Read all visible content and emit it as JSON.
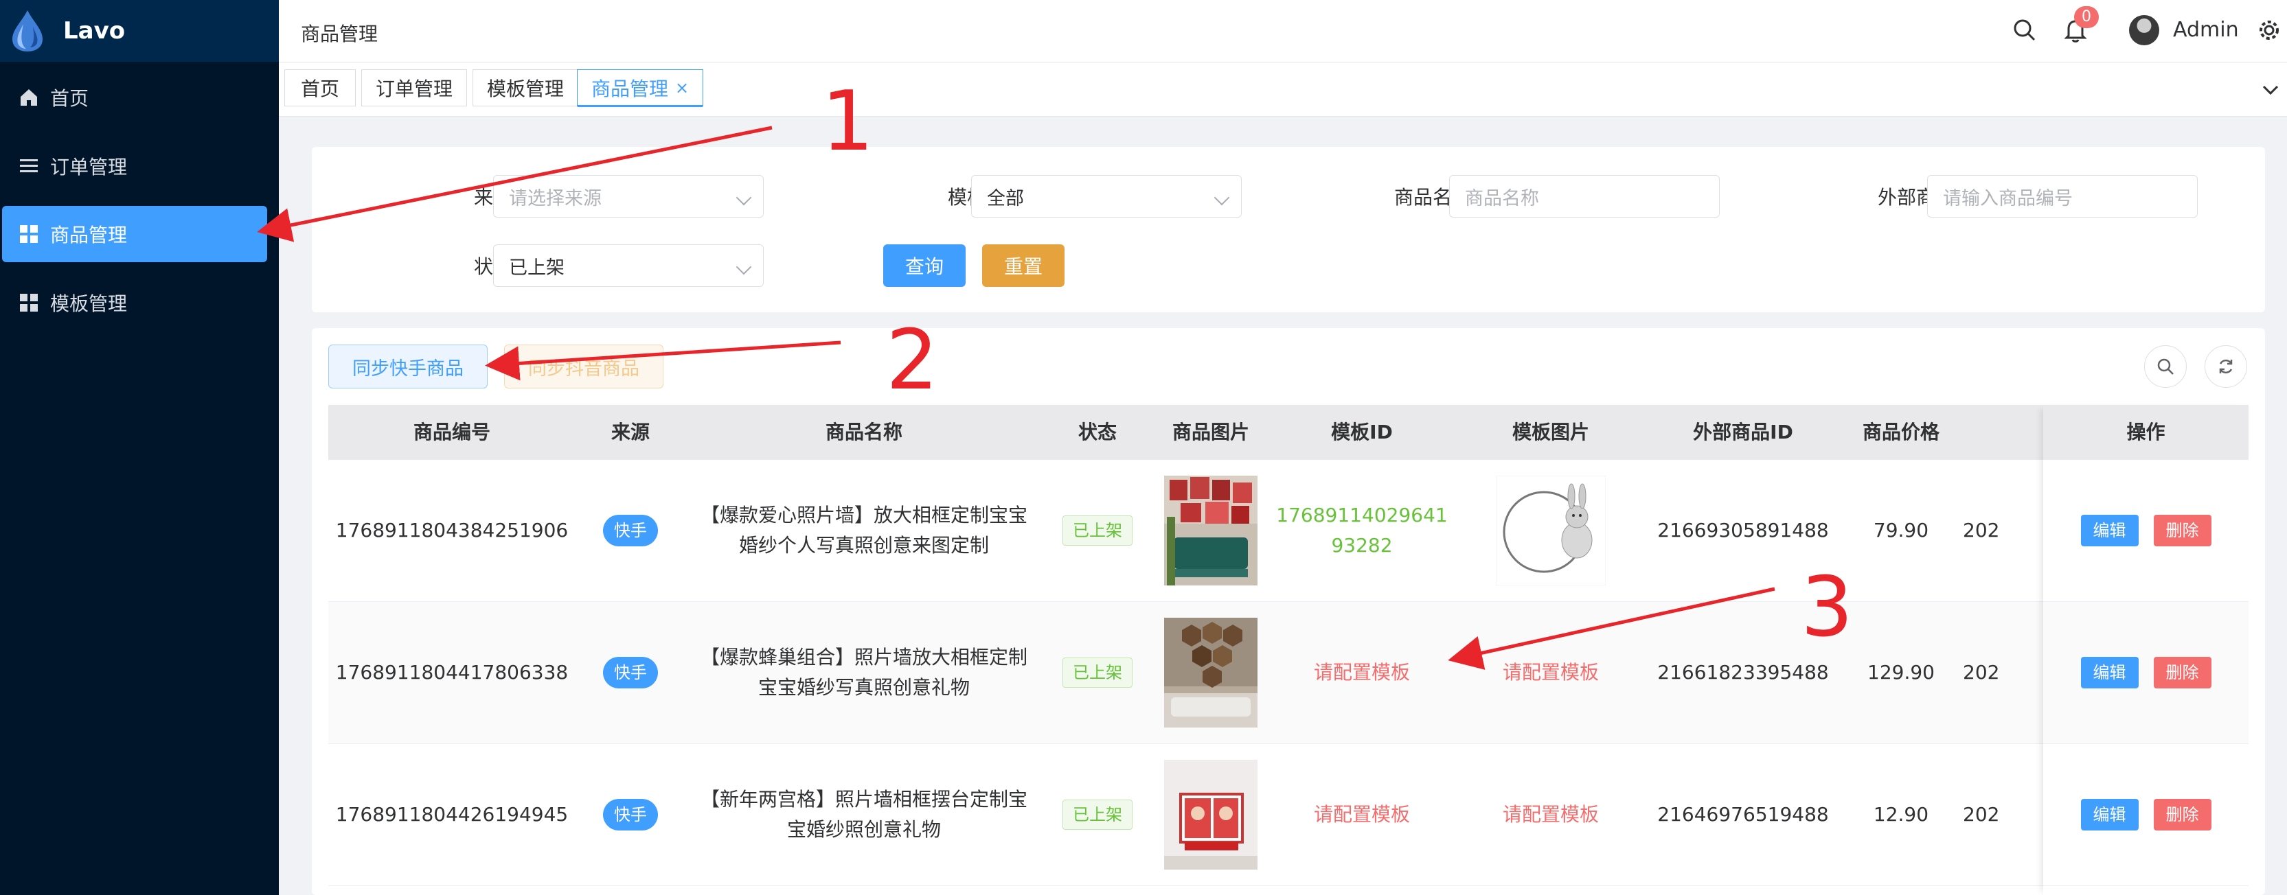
{
  "app": {
    "name": "Lavo"
  },
  "sidebar": {
    "items": [
      {
        "label": "首页",
        "icon": "home-icon"
      },
      {
        "label": "订单管理",
        "icon": "list-icon"
      },
      {
        "label": "商品管理",
        "icon": "grid-icon",
        "active": true
      },
      {
        "label": "模板管理",
        "icon": "grid-icon"
      }
    ]
  },
  "header": {
    "breadcrumb": "商品管理",
    "notification_count": "0",
    "user_name": "Admin"
  },
  "tags": [
    {
      "label": "首页"
    },
    {
      "label": "订单管理"
    },
    {
      "label": "模板管理"
    },
    {
      "label": "商品管理",
      "active": true,
      "close": "×"
    }
  ],
  "filters": {
    "source_label": "来源",
    "source_placeholder": "请选择来源",
    "template_label": "模板",
    "template_value": "全部",
    "name_label": "商品名称",
    "name_placeholder": "商品名称",
    "external_label": "外部商品编号",
    "external_placeholder": "请输入商品编号",
    "status_label": "状态",
    "status_value": "已上架",
    "search_button": "查询",
    "reset_button": "重置"
  },
  "toolbar": {
    "sync_kuaishou": "同步快手商品",
    "sync_douyin": "同步抖音商品"
  },
  "table": {
    "columns": [
      "商品编号",
      "来源",
      "商品名称",
      "状态",
      "商品图片",
      "模板ID",
      "模板图片",
      "外部商品ID",
      "商品价格",
      "操作"
    ],
    "rows": [
      {
        "id": "1768911804384251906",
        "source": "快手",
        "name": "【爆款爱心照片墙】放大相框定制宝宝婚纱个人写真照创意来图定制",
        "status": "已上架",
        "template_id": "1768911402964193282",
        "template_image": "",
        "external_id": "21669305891488",
        "price": "79.90",
        "truncated": "202"
      },
      {
        "id": "1768911804417806338",
        "source": "快手",
        "name": "【爆款蜂巢组合】照片墙放大相框定制宝宝婚纱写真照创意礼物",
        "status": "已上架",
        "template_id": "请配置模板",
        "template_image": "请配置模板",
        "external_id": "21661823395488",
        "price": "129.90",
        "truncated": "202"
      },
      {
        "id": "1768911804426194945",
        "source": "快手",
        "name": "【新年两宫格】照片墙相框摆台定制宝宝婚纱照创意礼物",
        "status": "已上架",
        "template_id": "请配置模板",
        "template_image": "请配置模板",
        "external_id": "21646976519488",
        "price": "12.90",
        "truncated": "202"
      }
    ],
    "actions": {
      "edit": "编辑",
      "delete": "删除"
    }
  },
  "annotations": [
    "1",
    "2",
    "3"
  ],
  "colors": {
    "sidebar_bg": "#001529",
    "accent": "#409eff",
    "warning": "#e6a23c",
    "danger": "#f56c6c",
    "success": "#67c23a",
    "annotation": "#e8252a"
  }
}
